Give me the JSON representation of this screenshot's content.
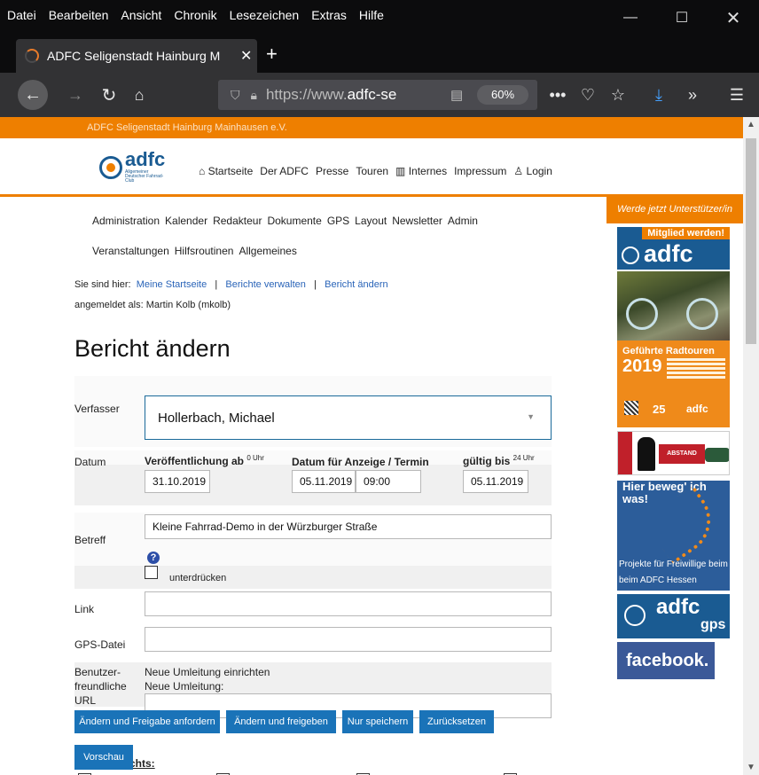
{
  "menubar": {
    "items": [
      "Datei",
      "Bearbeiten",
      "Ansicht",
      "Chronik",
      "Lesezeichen",
      "Extras",
      "Hilfe"
    ]
  },
  "tab": {
    "title": "ADFC Seligenstadt Hainburg M"
  },
  "urlbar": {
    "url_prefix": "https://www.",
    "url_host": "adfc-se",
    "zoom": "60%"
  },
  "site": {
    "topbar": "ADFC Seligenstadt Hainburg Mainhausen e.V.",
    "logo_word": "adfc",
    "logo_sub": "Allgemeiner Deutscher Fahrrad-Club",
    "nav": [
      "Startseite",
      "Der ADFC",
      "Presse",
      "Touren",
      "Internes",
      "Impressum",
      "Login"
    ],
    "subnav1": [
      "Administration",
      "Kalender",
      "Redakteur",
      "Dokumente",
      "GPS",
      "Layout",
      "Newsletter",
      "Admin"
    ],
    "subnav2": [
      "Veranstaltungen",
      "Hilfsroutinen",
      "Allgemeines"
    ]
  },
  "breadcrumb": {
    "prefix": "Sie sind hier:",
    "items": [
      "Meine Startseite",
      "Berichte verwalten",
      "Bericht ändern"
    ]
  },
  "logged_in": "angemeldet als: Martin Kolb (mkolb)",
  "page_title": "Bericht ändern",
  "form": {
    "verfasser_label": "Verfasser",
    "verfasser_value": "Hollerbach, Michael",
    "datum_label": "Datum",
    "pub_label": "Veröffentlichung ab",
    "pub_sup": "0 Uhr",
    "pub_value": "31.10.2019",
    "termin_label": "Datum für Anzeige / Termin",
    "termin_date": "05.11.2019",
    "termin_time": "09:00",
    "gueltig_label": "gültig bis",
    "gueltig_sup": "24 Uhr",
    "gueltig_value": "05.11.2019",
    "betreff_label": "Betreff",
    "betreff_value": "Kleine Fahrrad-Demo in der Würzburger Straße",
    "help": "?",
    "unterdruecken_label": "unterdrücken",
    "link_label": "Link",
    "gps_label": "GPS-Datei",
    "url_label_1": "Benutzer-",
    "url_label_2": "freundliche",
    "url_label_3": "URL",
    "umleitung_1": "Neue Umleitung einrichten",
    "umleitung_2": "Neue Umleitung:",
    "bottom_text": "chts:"
  },
  "buttons": {
    "freigabe_anfordern": "Ändern und Freigabe anfordern",
    "freigeben": "Ändern und freigeben",
    "speichern": "Nur speichern",
    "zuruecksetzen": "Zurücksetzen",
    "vorschau": "Vorschau"
  },
  "sidebar": {
    "banner": "Werde jetzt Unterstützer/in",
    "member_tag": "Mitglied werden!",
    "member_logo": "adfc",
    "tours_title": "Geführte Radtouren",
    "tours_year": "2019",
    "tours_25": "25",
    "tours_small": "adfc",
    "abstand": "ABSTAND",
    "verbs_title": "Hier beweg' ich was!",
    "verbs_caption": "Projekte für Freiwillige beim beim ADFC Hessen",
    "gps_word": "adfc",
    "gps_sub": "gps",
    "facebook": "facebook."
  }
}
